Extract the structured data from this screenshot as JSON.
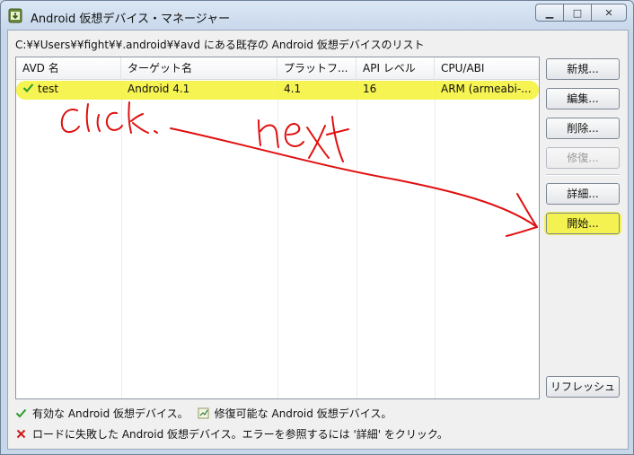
{
  "window": {
    "title": "Android 仮想デバイス・マネージャー",
    "controls": [
      "minimize",
      "maximize",
      "close"
    ]
  },
  "path_label": "C:¥¥Users¥¥fight¥¥.android¥¥avd にある既存の Android 仮想デバイスのリスト",
  "table": {
    "columns": [
      "AVD 名",
      "ターゲット名",
      "プラットフ...",
      "API レベル",
      "CPU/ABI"
    ],
    "rows": [
      {
        "status": "valid-check-icon",
        "avd": "test",
        "target": "Android 4.1",
        "platform": "4.1",
        "api": "16",
        "cpu": "ARM (armeabi-..."
      }
    ]
  },
  "buttons": {
    "new": "新規...",
    "edit": "編集...",
    "delete": "削除...",
    "repair": "修復...",
    "details": "詳細...",
    "start": "開始...",
    "refresh": "リフレッシュ"
  },
  "legend": {
    "valid": "有効な Android 仮想デバイス。",
    "repairable": "修復可能な Android 仮想デバイス。",
    "failed": "ロードに失敗した Android 仮想デバイス。エラーを参照するには '詳細' をクリック。"
  },
  "annotations": {
    "note_left": "click.",
    "note_right": "next",
    "highlight_color": "#f4f22c",
    "ink_color": "#e01010"
  }
}
